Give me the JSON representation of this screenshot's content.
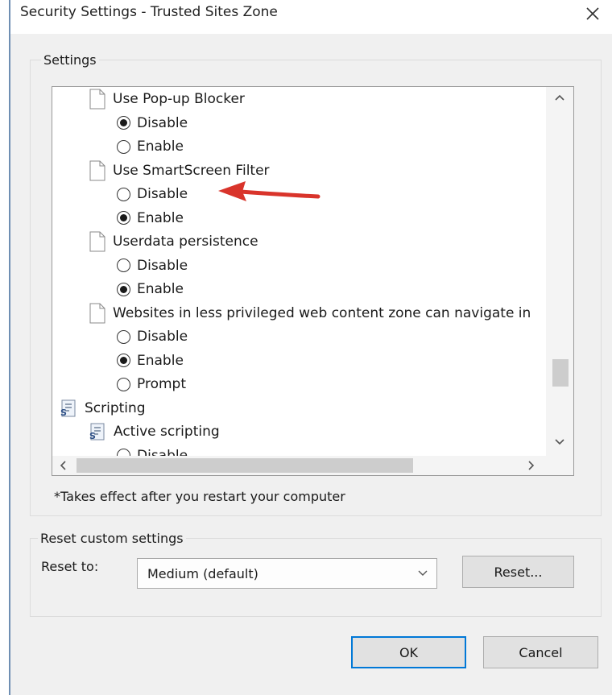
{
  "window": {
    "title": "Security Settings - Trusted Sites Zone",
    "close_glyph": "✕"
  },
  "settings_group": {
    "label": "Settings",
    "rows": [
      {
        "kind": "doc",
        "label": "Use Pop-up Blocker"
      },
      {
        "kind": "radio",
        "label": "Disable",
        "checked": true
      },
      {
        "kind": "radio",
        "label": "Enable",
        "checked": false
      },
      {
        "kind": "doc",
        "label": "Use SmartScreen Filter"
      },
      {
        "kind": "radio",
        "label": "Disable",
        "checked": false
      },
      {
        "kind": "radio",
        "label": "Enable",
        "checked": true
      },
      {
        "kind": "doc",
        "label": "Userdata persistence"
      },
      {
        "kind": "radio",
        "label": "Disable",
        "checked": false
      },
      {
        "kind": "radio",
        "label": "Enable",
        "checked": true
      },
      {
        "kind": "doc",
        "label": "Websites in less privileged web content zone can navigate in"
      },
      {
        "kind": "radio",
        "label": "Disable",
        "checked": false
      },
      {
        "kind": "radio",
        "label": "Enable",
        "checked": true
      },
      {
        "kind": "radio",
        "label": "Prompt",
        "checked": false
      },
      {
        "kind": "script",
        "label": "Scripting"
      },
      {
        "kind": "script",
        "label": "Active scripting"
      },
      {
        "kind": "radio",
        "label": "Disable",
        "checked": false
      }
    ],
    "note": "*Takes effect after you restart your computer"
  },
  "reset_group": {
    "label": "Reset custom settings",
    "reset_to_label": "Reset to:",
    "selected_level": "Medium (default)",
    "reset_button": "Reset..."
  },
  "footer": {
    "ok": "OK",
    "cancel": "Cancel"
  },
  "colors": {
    "annotation_arrow": "#d9342b",
    "default_button_border": "#0078d7"
  }
}
